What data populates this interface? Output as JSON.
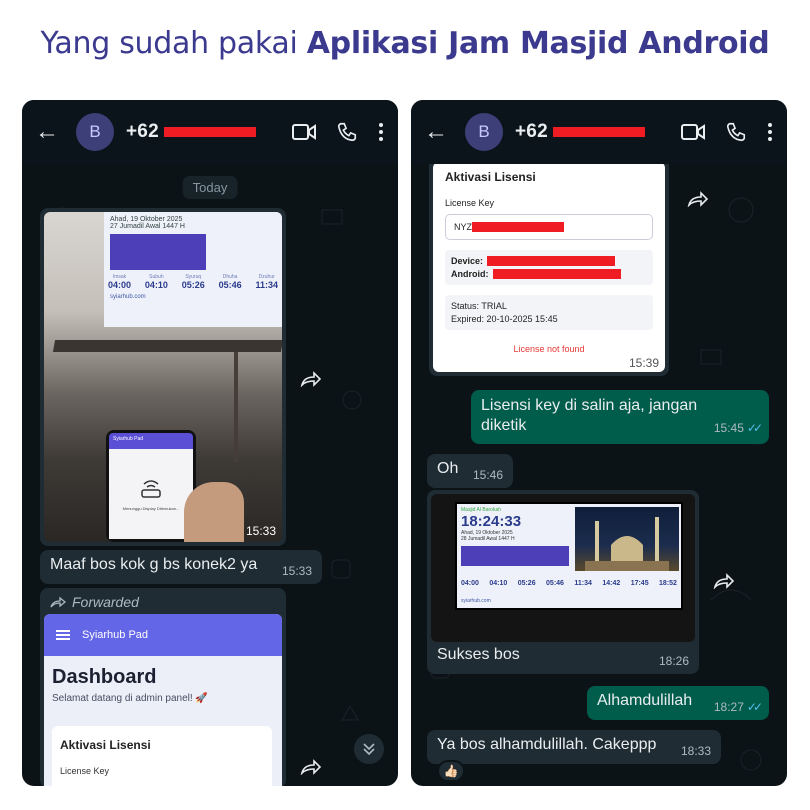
{
  "headline": {
    "regular": "Yang sudah pakai ",
    "bold": "Aplikasi Jam Masjid Android"
  },
  "left_chat": {
    "avatar": "B",
    "contact": "+62",
    "day_chip": "Today",
    "photo_time": "15:33",
    "tv": {
      "date": "Ahad, 19 Oktober 2025",
      "hijri": "27 Jumadil Awal 1447 H",
      "prayers": [
        {
          "name": "Imsak",
          "time": "04:00"
        },
        {
          "name": "Subuh",
          "time": "04:10"
        },
        {
          "name": "Syuruq",
          "time": "05:26"
        },
        {
          "name": "Dhuha",
          "time": "05:46"
        },
        {
          "name": "Dzuhur",
          "time": "11:34"
        }
      ],
      "url": "syiarhub.com"
    },
    "phone_screen": {
      "app": "Syiarhub Pad",
      "status": "Menunggu Display Ditemukan..."
    },
    "msg1": {
      "text": "Maaf bos kok g bs konek2 ya",
      "time": "15:33"
    },
    "forwarded_label": "Forwarded",
    "dashboard": {
      "app": "Syiarhub Pad",
      "title": "Dashboard",
      "subtitle": "Selamat datang di admin panel! 🚀",
      "card_title": "Aktivasi Lisensi",
      "field_label": "License Key"
    }
  },
  "right_chat": {
    "avatar": "B",
    "contact": "+62",
    "license_card": {
      "title": "Aktivasi Lisensi",
      "key_label": "License Key",
      "key_prefix": "NYZ",
      "device_label": "Device:",
      "android_label": "Android:",
      "status": "Status: TRIAL",
      "expired": "Expired: 20-10-2025 15:45",
      "error": "License not found",
      "time": "15:39"
    },
    "msg_out1": {
      "text": "Lisensi key di salin aja, jangan diketik",
      "time": "15:45"
    },
    "msg_in1": {
      "text": "Oh",
      "time": "15:46"
    },
    "photo2": {
      "masjid": "Masjid Al Barokah",
      "clock": "18:24:33",
      "date": "Ahad, 19 Oktober 2025",
      "hijri": "28 Jumadil Awal 1447 H",
      "prayers": [
        "04:00",
        "04:10",
        "05:26",
        "05:46",
        "11:34",
        "14:42",
        "17:45",
        "18:52"
      ],
      "url": "syiarhub.com",
      "caption": "Sukses bos",
      "time": "18:26"
    },
    "msg_out2": {
      "text": "Alhamdulillah",
      "time": "18:27"
    },
    "msg_in2": {
      "text": "Ya bos alhamdulillah. Cakeppp",
      "time": "18:33",
      "reaction": "👍🏻"
    }
  },
  "colors": {
    "headline": "#3b3a8f",
    "chat_bg": "#0c1317",
    "bubble_in": "#1f2c34",
    "bubble_out": "#005c4b",
    "read_ticks": "#53bdeb",
    "app_purple": "#6466e8",
    "redaction": "#ef1c24"
  },
  "icons": [
    "back-arrow-icon",
    "video-call-icon",
    "phone-icon",
    "more-vertical-icon",
    "forward-icon",
    "scroll-down-icon",
    "hamburger-menu-icon",
    "wifi-router-icon"
  ]
}
